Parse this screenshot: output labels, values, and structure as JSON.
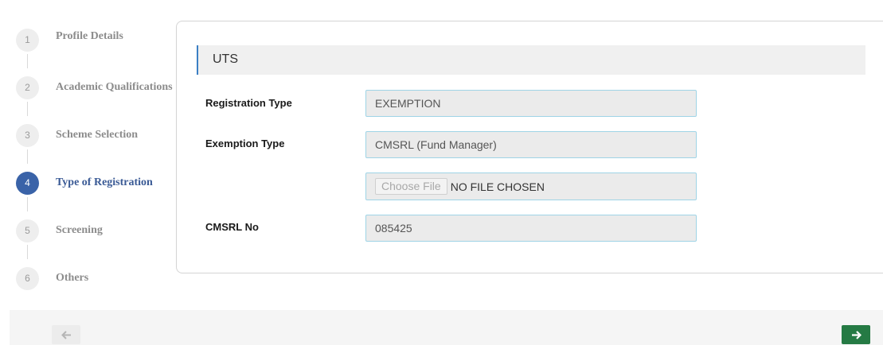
{
  "stepper": {
    "steps": [
      {
        "number": "1",
        "label": "Profile Details"
      },
      {
        "number": "2",
        "label": "Academic Qualifications"
      },
      {
        "number": "3",
        "label": "Scheme Selection"
      },
      {
        "number": "4",
        "label": "Type of Registration"
      },
      {
        "number": "5",
        "label": "Screening"
      },
      {
        "number": "6",
        "label": "Others"
      }
    ],
    "active_step": "4"
  },
  "section": {
    "title": "UTS"
  },
  "form": {
    "registration_type": {
      "label": "Registration Type",
      "value": "EXEMPTION"
    },
    "exemption_type": {
      "label": "Exemption Type",
      "value": "CMSRL (Fund Manager)"
    },
    "file_upload": {
      "button_label": "Choose File",
      "status": "NO FILE CHOSEN"
    },
    "cmsrl_no": {
      "label": "CMSRL No",
      "value": "085425"
    }
  },
  "navigation": {
    "prev_icon": "arrow-left-icon",
    "next_icon": "arrow-right-icon"
  },
  "colors": {
    "active_step": "#3a63a8",
    "accent_border": "#3b7fc4",
    "input_border": "#9fd4e6",
    "next_button": "#257a44"
  }
}
